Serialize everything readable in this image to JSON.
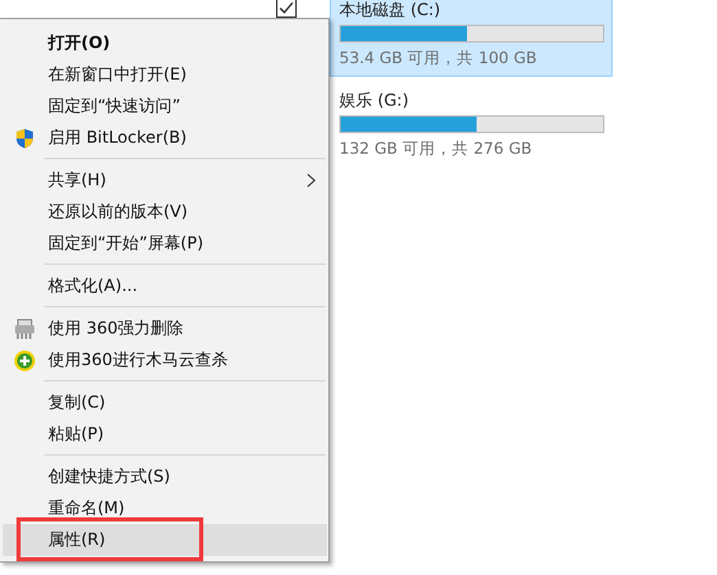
{
  "drives": [
    {
      "name": "本地磁盘 (C:)",
      "level": 0.48,
      "space": "53.4 GB 可用，共 100 GB",
      "selected": true,
      "checked": true
    },
    {
      "name": "娱乐 (G:)",
      "level": 0.52,
      "space": "132 GB 可用，共 276 GB",
      "selected": false
    }
  ],
  "context_menu": {
    "items": [
      {
        "kind": "item",
        "label": "打开(O)",
        "bold": true,
        "selected": false
      },
      {
        "kind": "item",
        "label": "在新窗口中打开(E)",
        "selected": false
      },
      {
        "kind": "item",
        "label": "固定到“快速访问”",
        "selected": false
      },
      {
        "kind": "item",
        "label": "启用 BitLocker(B)",
        "selected": false
      },
      {
        "kind": "separator"
      },
      {
        "kind": "item",
        "label": "共享(H)",
        "submenu": true,
        "selected": false
      },
      {
        "kind": "item",
        "label": "还原以前的版本(V)",
        "selected": false
      },
      {
        "kind": "item",
        "label": "固定到“开始”屏幕(P)",
        "selected": false
      },
      {
        "kind": "separator"
      },
      {
        "kind": "item",
        "label": "格式化(A)...",
        "selected": false
      },
      {
        "kind": "separator"
      },
      {
        "kind": "item",
        "label": "使用 360强力删除",
        "selected": false
      },
      {
        "kind": "item",
        "label": "使用360进行木马云查杀",
        "selected": false
      },
      {
        "kind": "separator"
      },
      {
        "kind": "item",
        "label": "复制(C)",
        "selected": false
      },
      {
        "kind": "item",
        "label": "粘贴(P)",
        "selected": false
      },
      {
        "kind": "separator"
      },
      {
        "kind": "item",
        "label": "创建快捷方式(S)",
        "selected": false
      },
      {
        "kind": "item",
        "label": "重命名(M)",
        "selected": false
      },
      {
        "kind": "item",
        "label": "属性(R)",
        "selected": true,
        "highlighted": true
      }
    ]
  }
}
